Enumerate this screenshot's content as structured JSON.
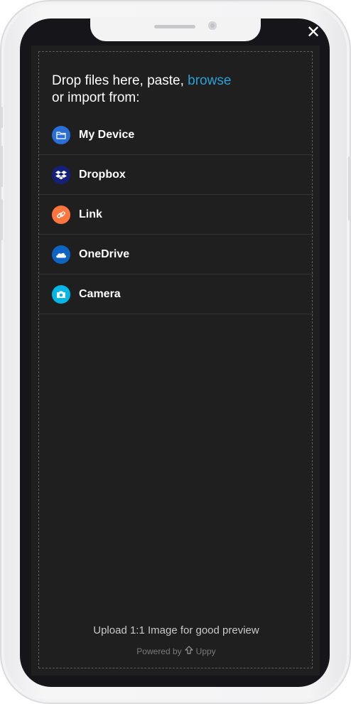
{
  "window": {
    "close_label": "✕"
  },
  "dropzone": {
    "title_prefix": "Drop files here, paste, ",
    "browse_label": "browse",
    "title_suffix": "or import from:"
  },
  "sources": [
    {
      "label": "My Device",
      "icon": "folder-icon",
      "color": "#2a6fd6"
    },
    {
      "label": "Dropbox",
      "icon": "dropbox-icon",
      "color": "#15207a"
    },
    {
      "label": "Link",
      "icon": "link-icon",
      "color": "#ff753e"
    },
    {
      "label": "OneDrive",
      "icon": "onedrive-icon",
      "color": "#0d64c2"
    },
    {
      "label": "Camera",
      "icon": "camera-icon",
      "color": "#00b7e6"
    }
  ],
  "footer": {
    "note": "Upload 1:1 Image for good preview",
    "powered_prefix": "Powered by",
    "brand": "Uppy"
  },
  "colors": {
    "accent": "#2aa0d8",
    "panel_bg": "#1f1f1f"
  }
}
